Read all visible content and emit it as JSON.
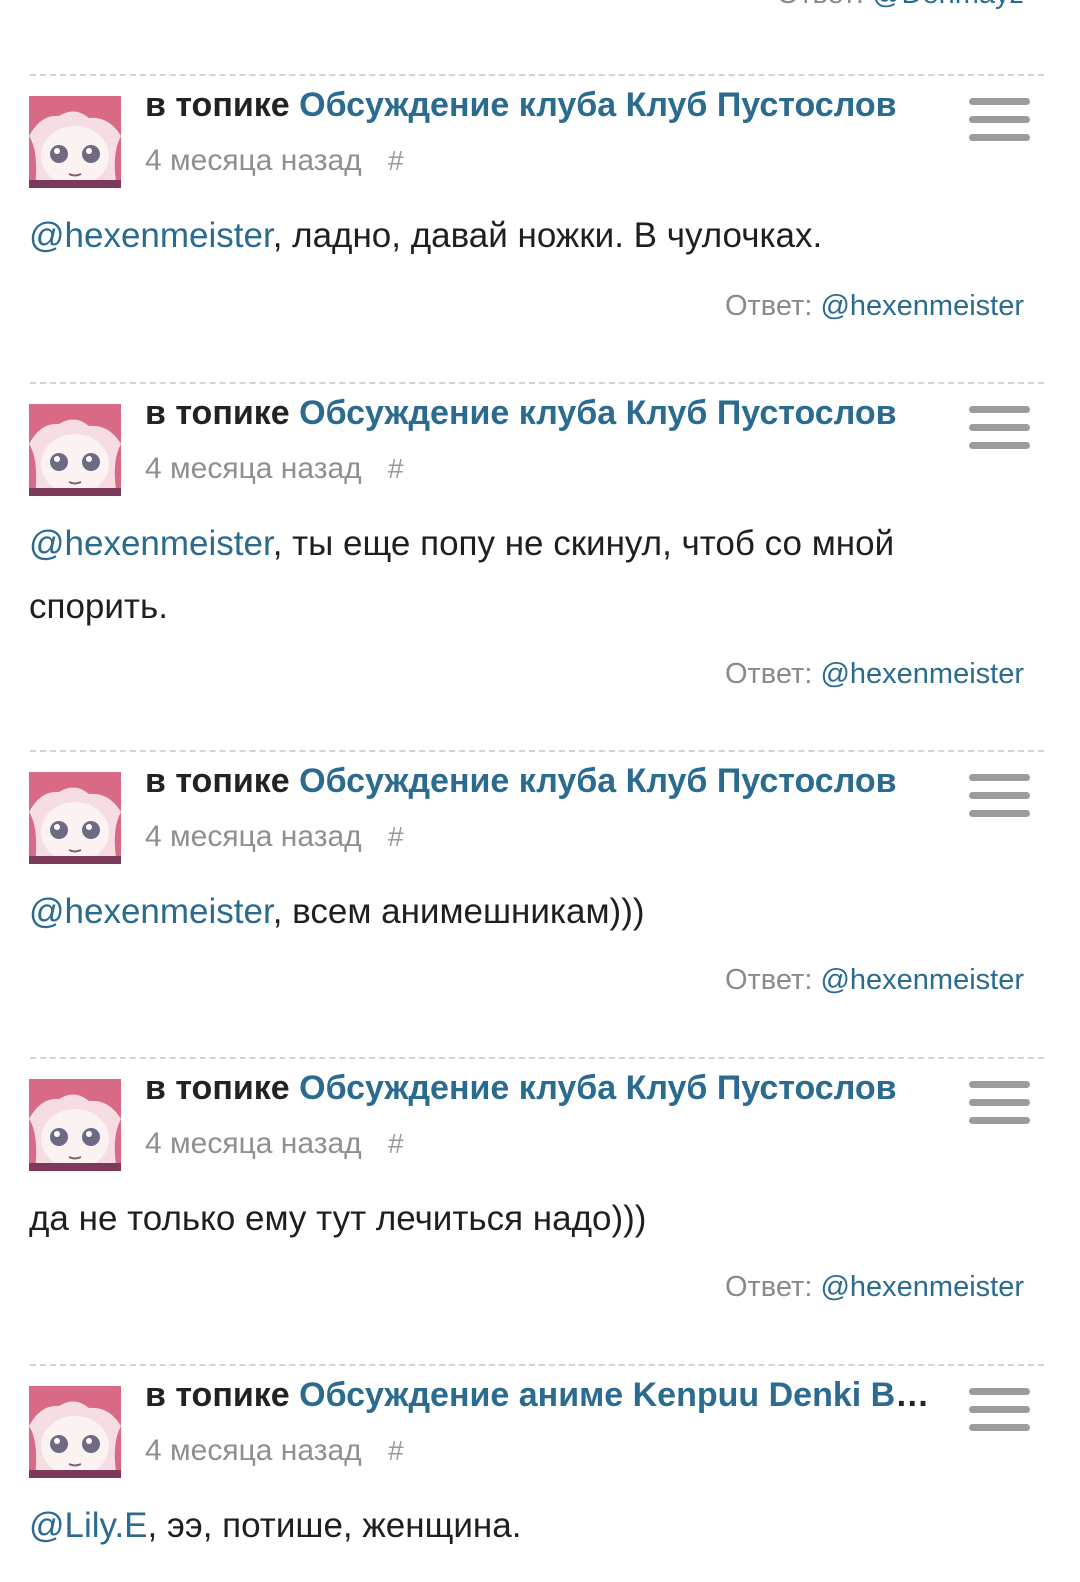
{
  "top_reply": {
    "label": "Ответ:",
    "mention": "@Denmayz"
  },
  "posts": [
    {
      "prefix": "в топике",
      "topic": "Обсуждение клуба Клуб Пустослов",
      "time": "4 месяца назад",
      "hash": "#",
      "mention": "@hexenmeister",
      "text": ", ладно, давай ножки. В чулочках.",
      "reply_label": "Ответ:",
      "reply_mention": "@hexenmeister"
    },
    {
      "prefix": "в топике",
      "topic": "Обсуждение клуба Клуб Пустослов",
      "time": "4 месяца назад",
      "hash": "#",
      "mention": "@hexenmeister",
      "text": ", ты еще попу не скинул, чтоб со мной спорить.",
      "reply_label": "Ответ:",
      "reply_mention": "@hexenmeister"
    },
    {
      "prefix": "в топике",
      "topic": "Обсуждение клуба Клуб Пустослов",
      "time": "4 месяца назад",
      "hash": "#",
      "mention": "@hexenmeister",
      "text": ", всем анимешникам)))",
      "reply_label": "Ответ:",
      "reply_mention": "@hexenmeister"
    },
    {
      "prefix": "в топике",
      "topic": "Обсуждение клуба Клуб Пустослов",
      "time": "4 месяца назад",
      "hash": "#",
      "mention": "",
      "text": "да не только ему тут лечиться надо)))",
      "reply_label": "Ответ:",
      "reply_mention": "@hexenmeister"
    },
    {
      "prefix": "в топике",
      "topic": "Обсуждение аниме Kenpuu Denki Berserk",
      "time": "4 месяца назад",
      "hash": "#",
      "mention": "@Lily.E",
      "text": ", ээ, потише, женщина.",
      "reply_label": "",
      "reply_mention": ""
    }
  ],
  "icons": {
    "menu": "hamburger-menu-icon",
    "avatar": "user-avatar-anime-girl"
  },
  "colors": {
    "link": "#2b6b8f",
    "meta": "#8f8f8f",
    "menu": "#9c9c9c",
    "divider": "#d4d4d4"
  }
}
